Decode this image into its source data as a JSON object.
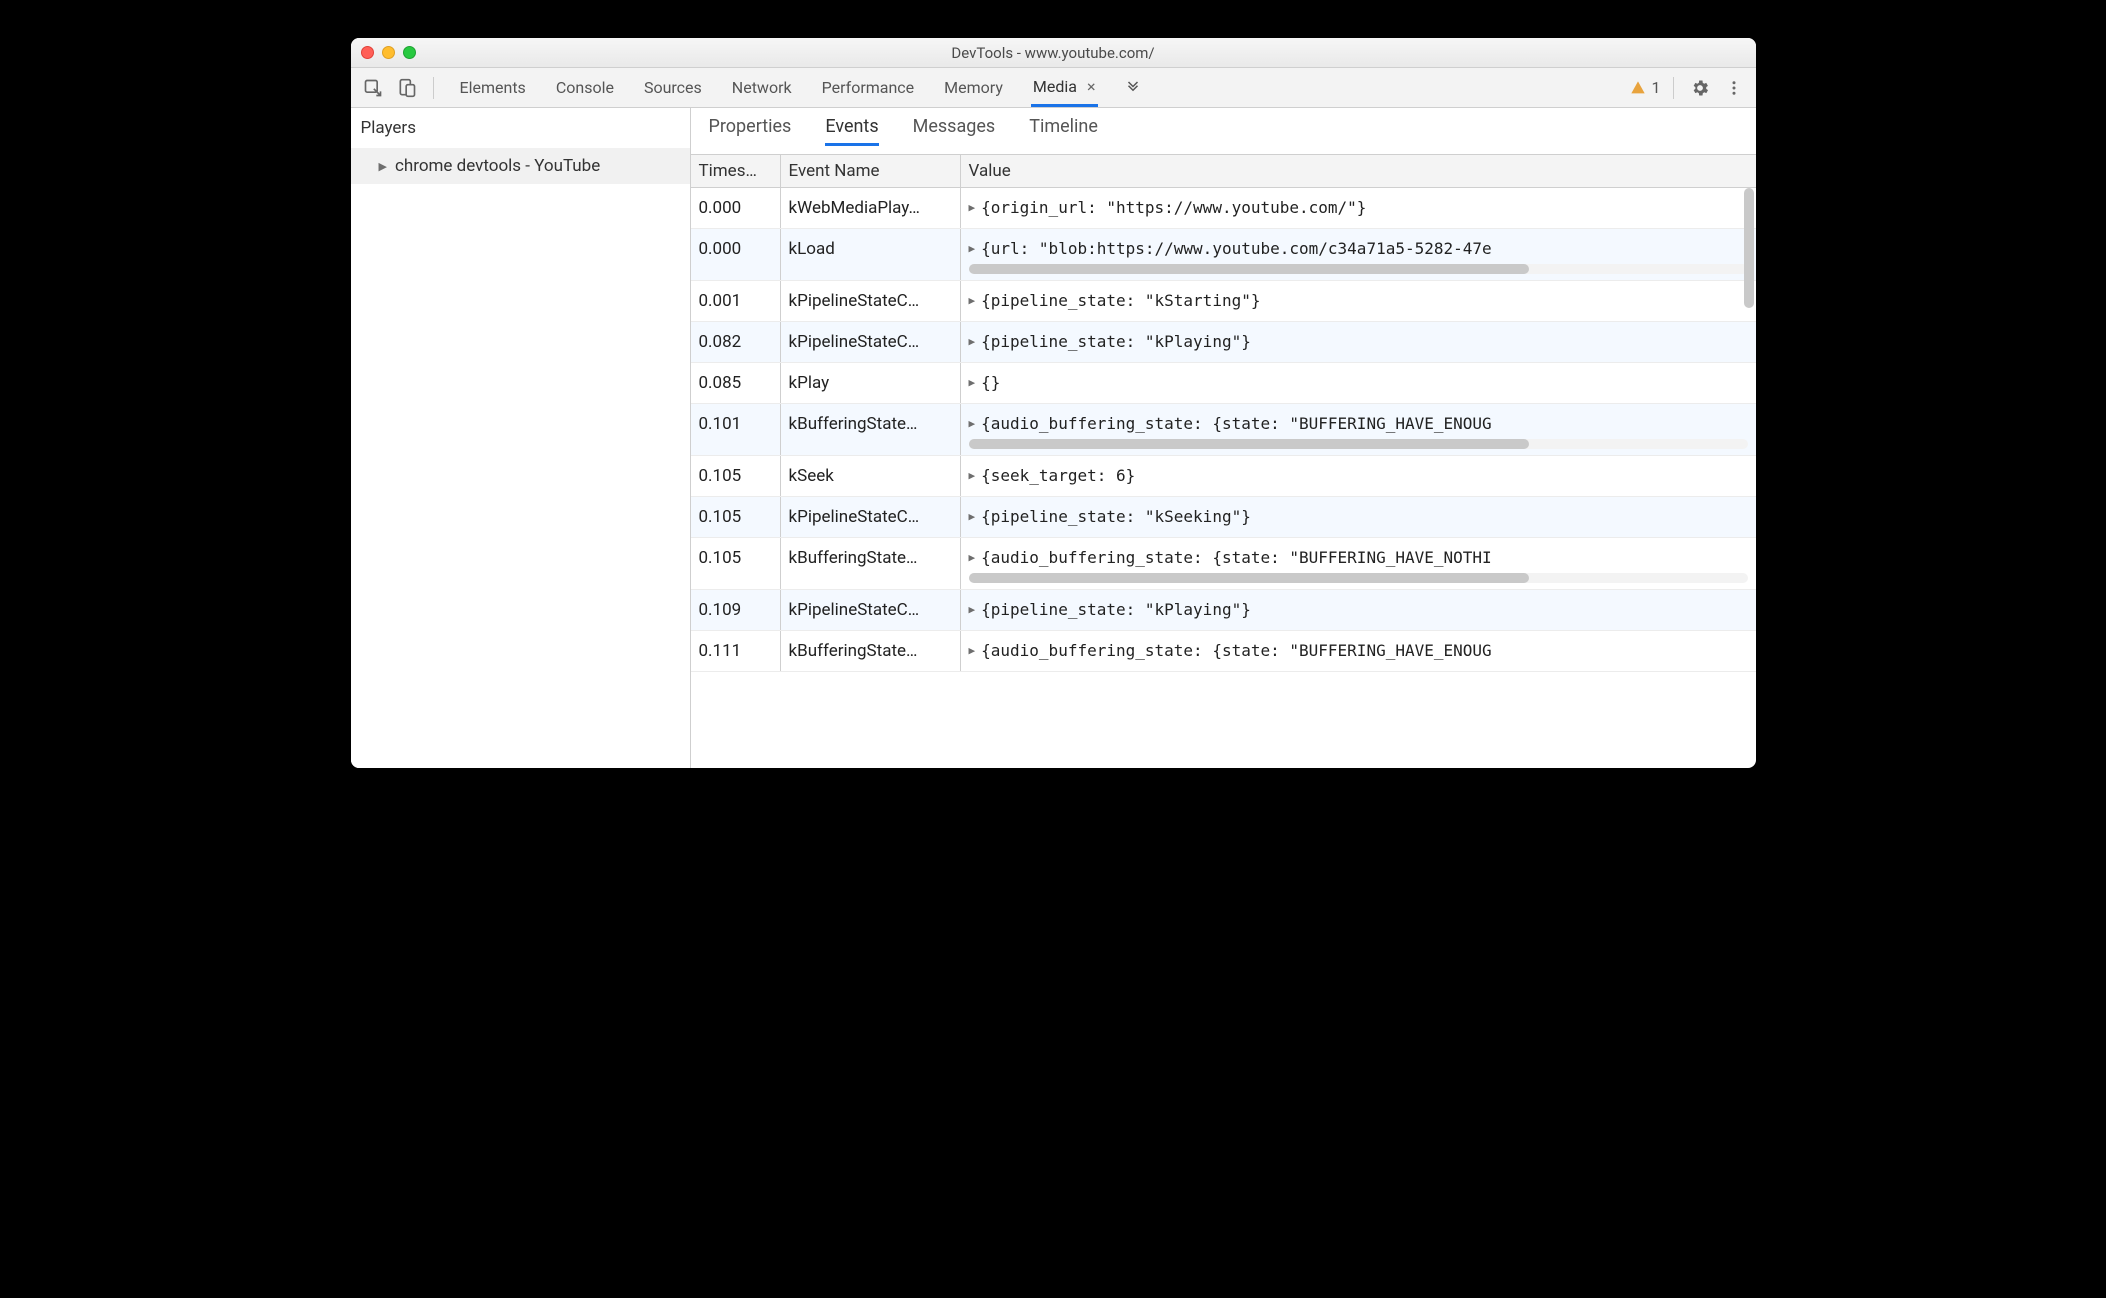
{
  "window": {
    "title": "DevTools - www.youtube.com/"
  },
  "toolbar": {
    "tabs": [
      "Elements",
      "Console",
      "Sources",
      "Network",
      "Performance",
      "Memory",
      "Media"
    ],
    "active_tab": "Media",
    "warnings_count": "1"
  },
  "sidebar": {
    "title": "Players",
    "item": "chrome devtools - YouTube"
  },
  "subtabs": {
    "items": [
      "Properties",
      "Events",
      "Messages",
      "Timeline"
    ],
    "active": "Events"
  },
  "headers": {
    "timestamp": "Times…",
    "event_name": "Event Name",
    "value": "Value"
  },
  "rows": [
    {
      "ts": "0.000",
      "name": "kWebMediaPlay…",
      "value": "{origin_url: \"https://www.youtube.com/\"}",
      "scroll": false
    },
    {
      "ts": "0.000",
      "name": "kLoad",
      "value": "{url: \"blob:https://www.youtube.com/c34a71a5-5282-47e",
      "scroll": true
    },
    {
      "ts": "0.001",
      "name": "kPipelineStateC…",
      "value": "{pipeline_state: \"kStarting\"}",
      "scroll": false
    },
    {
      "ts": "0.082",
      "name": "kPipelineStateC…",
      "value": "{pipeline_state: \"kPlaying\"}",
      "scroll": false
    },
    {
      "ts": "0.085",
      "name": "kPlay",
      "value": "{}",
      "scroll": false
    },
    {
      "ts": "0.101",
      "name": "kBufferingState…",
      "value": "{audio_buffering_state: {state: \"BUFFERING_HAVE_ENOUG",
      "scroll": true
    },
    {
      "ts": "0.105",
      "name": "kSeek",
      "value": "{seek_target: 6}",
      "scroll": false
    },
    {
      "ts": "0.105",
      "name": "kPipelineStateC…",
      "value": "{pipeline_state: \"kSeeking\"}",
      "scroll": false
    },
    {
      "ts": "0.105",
      "name": "kBufferingState…",
      "value": "{audio_buffering_state: {state: \"BUFFERING_HAVE_NOTHI",
      "scroll": true
    },
    {
      "ts": "0.109",
      "name": "kPipelineStateC…",
      "value": "{pipeline_state: \"kPlaying\"}",
      "scroll": false
    },
    {
      "ts": "0.111",
      "name": "kBufferingState…",
      "value": "{audio_buffering_state: {state: \"BUFFERING_HAVE_ENOUG",
      "scroll": false
    }
  ]
}
